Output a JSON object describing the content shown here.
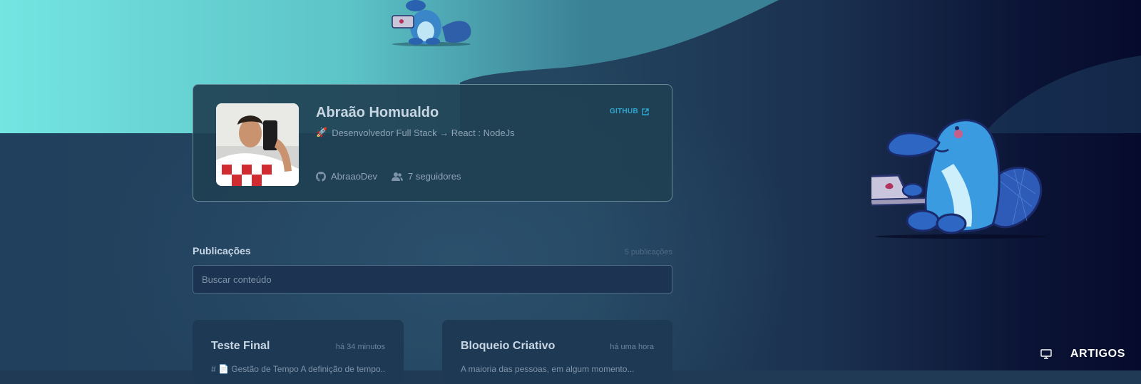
{
  "profile": {
    "name": "Abraão Homualdo",
    "bio_emoji": "🚀",
    "bio": "Desenvolvedor Full Stack → React : NodeJs",
    "github_label": "GITHUB",
    "username": "AbraaoDev",
    "followers": "7 seguidores"
  },
  "publications": {
    "title": "Publicações",
    "count": "5 publicações",
    "search_placeholder": "Buscar conteúdo"
  },
  "posts": [
    {
      "title": "Teste Final",
      "time": "há 34 minutos",
      "excerpt": "# 📄 Gestão de Tempo A definição de tempo..."
    },
    {
      "title": "Bloqueio Criativo",
      "time": "há uma hora",
      "excerpt": "A maioria das pessoas, em algum momento..."
    }
  ],
  "nav": {
    "articles_label": "ARTIGOS"
  },
  "colors": {
    "accent": "#2fa7d0",
    "teal": "#6fe3e0",
    "background": "#203a55"
  },
  "icons": [
    "github-icon",
    "users-icon",
    "external-link-icon",
    "monitor-icon",
    "rocket-icon"
  ]
}
